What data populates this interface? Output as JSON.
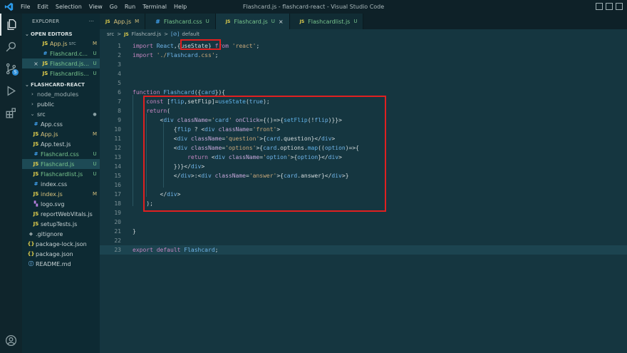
{
  "titlebar": {
    "menu": [
      "File",
      "Edit",
      "Selection",
      "View",
      "Go",
      "Run",
      "Terminal",
      "Help"
    ],
    "title": "Flashcard.js - flashcard-react - Visual Studio Code"
  },
  "activity": {
    "scm_badge": "5"
  },
  "sidebar": {
    "title": "EXPLORER",
    "more": "···",
    "open_editors_title": "OPEN EDITORS",
    "open_editors": [
      {
        "icon": "JS",
        "name": "App.js",
        "desc": "src",
        "status": "M"
      },
      {
        "icon": "#",
        "name": "Flashcard.c...",
        "desc": "",
        "status": "U"
      },
      {
        "icon": "JS",
        "name": "Flashcard.js...",
        "desc": "",
        "status": "U",
        "close": "×"
      },
      {
        "icon": "JS",
        "name": "Flashcardlis...",
        "desc": "",
        "status": "U"
      }
    ],
    "project_title": "FLASHCARD-REACT",
    "tree": [
      {
        "icon": "›",
        "name": "node_modules",
        "status": ""
      },
      {
        "icon": "›",
        "name": "public",
        "status": ""
      },
      {
        "icon": "⌄",
        "name": "src",
        "status": "●"
      },
      {
        "icon": "#",
        "name": "App.css",
        "status": ""
      },
      {
        "icon": "JS",
        "name": "App.js",
        "status": "M"
      },
      {
        "icon": "JS",
        "name": "App.test.js",
        "status": ""
      },
      {
        "icon": "#",
        "name": "Flashcard.css",
        "status": "U"
      },
      {
        "icon": "JS",
        "name": "Flashcard.js",
        "status": "U"
      },
      {
        "icon": "JS",
        "name": "Flashcardlist.js",
        "status": "U"
      },
      {
        "icon": "#",
        "name": "index.css",
        "status": ""
      },
      {
        "icon": "JS",
        "name": "index.js",
        "status": "M"
      },
      {
        "icon": "▚",
        "name": "logo.svg",
        "status": ""
      },
      {
        "icon": "JS",
        "name": "reportWebVitals.js",
        "status": ""
      },
      {
        "icon": "JS",
        "name": "setupTests.js",
        "status": ""
      },
      {
        "icon": "◆",
        "name": ".gitignore",
        "status": ""
      },
      {
        "icon": "{}",
        "name": "package-lock.json",
        "status": ""
      },
      {
        "icon": "{}",
        "name": "package.json",
        "status": ""
      },
      {
        "icon": "ⓘ",
        "name": "README.md",
        "status": ""
      }
    ]
  },
  "tabs": [
    {
      "icon": "JS",
      "name": "App.js",
      "status": "M"
    },
    {
      "icon": "#",
      "name": "Flashcard.css",
      "status": "U"
    },
    {
      "icon": "JS",
      "name": "Flashcard.js",
      "status": "U",
      "close": "×"
    },
    {
      "icon": "JS",
      "name": "Flashcardlist.js",
      "status": "U"
    }
  ],
  "breadcrumb": {
    "folder": "src",
    "sep1": ">",
    "file_icon": "JS",
    "file": "Flashcard.js",
    "sep2": ">",
    "symbol_icon": "[⊘]",
    "symbol": "default"
  },
  "code_lines": [
    {
      "n": "1",
      "code": "import React,{useState} from 'react';"
    },
    {
      "n": "2",
      "code": "import './Flashcard.css';"
    },
    {
      "n": "3",
      "code": ""
    },
    {
      "n": "4",
      "code": ""
    },
    {
      "n": "5",
      "code": ""
    },
    {
      "n": "6",
      "code": "function Flashcard({card}){"
    },
    {
      "n": "7",
      "code": "    const [flip,setFlip]=useState(true);"
    },
    {
      "n": "8",
      "code": "    return("
    },
    {
      "n": "9",
      "code": "        <div className='card' onClick={()=>{setFlip(!flip)}}>"
    },
    {
      "n": "10",
      "code": "            {flip ? <div className='front'>"
    },
    {
      "n": "11",
      "code": "            <div className='question'>{card.question}</div>"
    },
    {
      "n": "12",
      "code": "            <div className='options'>{card.options.map((option)=>{"
    },
    {
      "n": "13",
      "code": "                return <div className='option'>{option}</div>"
    },
    {
      "n": "14",
      "code": "            })}</div>"
    },
    {
      "n": "15",
      "code": "            </div>:<div className='answer'>{card.answer}</div>}"
    },
    {
      "n": "16",
      "code": ""
    },
    {
      "n": "17",
      "code": "        </div>"
    },
    {
      "n": "18",
      "code": "    );"
    },
    {
      "n": "19",
      "code": ""
    },
    {
      "n": "20",
      "code": ""
    },
    {
      "n": "21",
      "code": "}"
    },
    {
      "n": "22",
      "code": ""
    },
    {
      "n": "23",
      "code": "export default Flashcard;"
    }
  ],
  "colors": {
    "highlight_box": "#e02020",
    "editor_bg": "#153640",
    "sidebar_bg": "#0d2a33"
  }
}
